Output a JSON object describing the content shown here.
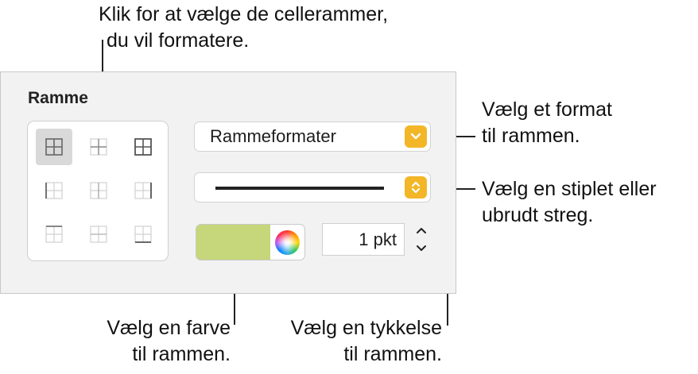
{
  "callouts": {
    "cell_borders": [
      "Klik for at vælge de cellerammer,",
      "du vil formatere."
    ],
    "format": [
      "Vælg et format",
      "til rammen."
    ],
    "line_style": [
      "Vælg en stiplet eller",
      "ubrudt streg."
    ],
    "color": [
      "Vælg en farve",
      "til rammen."
    ],
    "thickness": [
      "Vælg en tykkelse",
      "til rammen."
    ]
  },
  "panel": {
    "section_label": "Ramme",
    "border_style_popup": "Rammeformater",
    "line_style": "solid",
    "border_color": "#c6d67a",
    "width_value": "1 pkt"
  },
  "border_cells": [
    {
      "name": "all-borders",
      "selected": true
    },
    {
      "name": "inside-borders",
      "selected": false
    },
    {
      "name": "outside-borders",
      "selected": false
    },
    {
      "name": "left-border",
      "selected": false
    },
    {
      "name": "vertical-inside-border",
      "selected": false
    },
    {
      "name": "right-border",
      "selected": false
    },
    {
      "name": "top-border",
      "selected": false
    },
    {
      "name": "horizontal-inside-border",
      "selected": false
    },
    {
      "name": "bottom-border",
      "selected": false
    }
  ],
  "colors": {
    "accent_popup": "#f3b627",
    "panel_bg": "#f2f2f2"
  }
}
